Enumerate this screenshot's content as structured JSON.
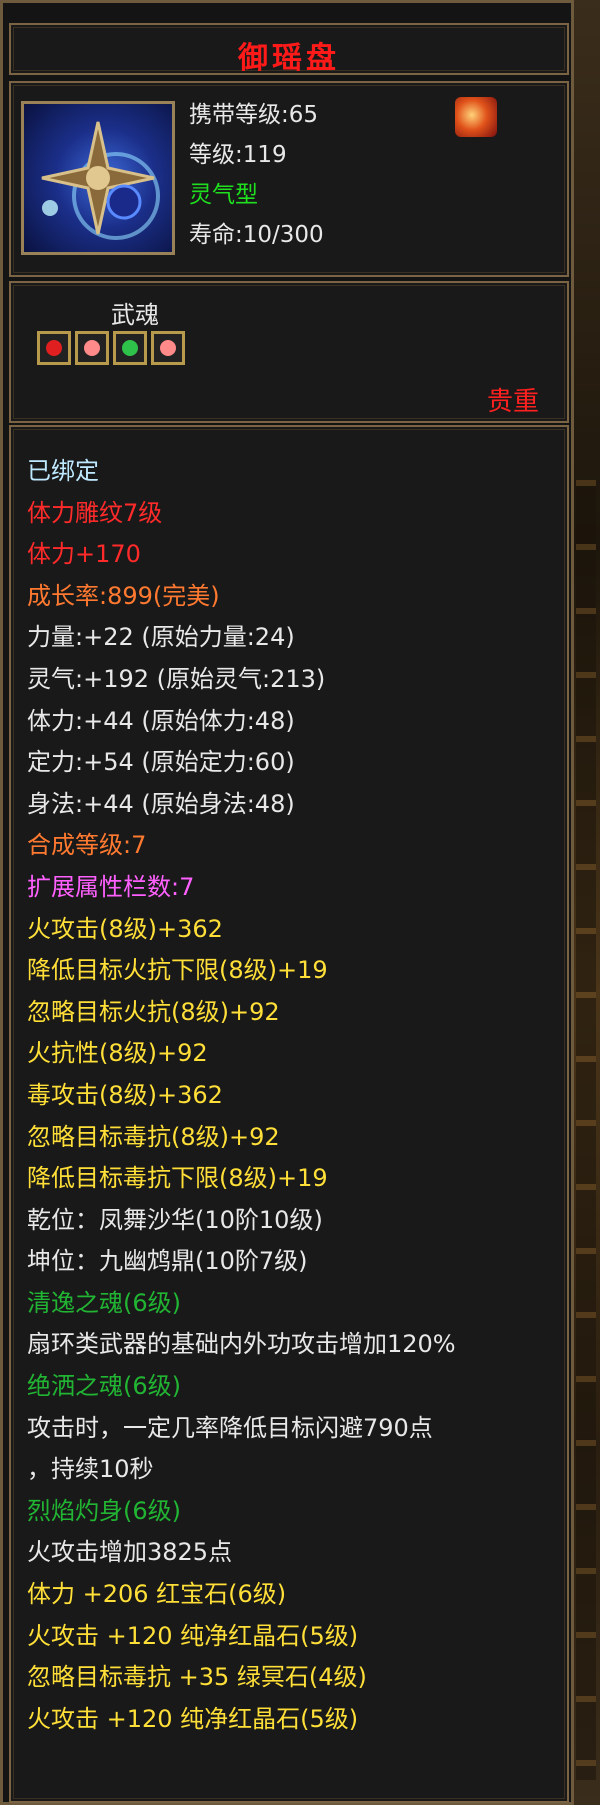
{
  "tooltip": {
    "title": "御瑶盘",
    "carry_level": "携带等级:65",
    "level": "等级:119",
    "type": "灵气型",
    "lifespan": "寿命:10/300",
    "soul_label": "武魂",
    "rarity": "贵重",
    "icons": {
      "item": "shuriken-disc-icon",
      "badge": "flame-badge-icon",
      "gems": [
        "red-gem-icon",
        "pink-gem-icon",
        "green-gem-icon",
        "pink-gem-icon"
      ]
    },
    "colors": {
      "title": "#ff1a1a",
      "green": "#1ee01e",
      "precious": "#ff2020",
      "gold": "#ffdf38"
    },
    "lines": [
      {
        "text": "已绑定",
        "color": "cyan"
      },
      {
        "text": "体力雕纹7级",
        "color": "red"
      },
      {
        "text": "体力+170",
        "color": "red"
      },
      {
        "text": "成长率:899(完美)",
        "color": "orange"
      },
      {
        "text": "力量:+22 (原始力量:24)",
        "color": "white"
      },
      {
        "text": "灵气:+192 (原始灵气:213)",
        "color": "white"
      },
      {
        "text": "体力:+44 (原始体力:48)",
        "color": "white"
      },
      {
        "text": "定力:+54 (原始定力:60)",
        "color": "white"
      },
      {
        "text": "身法:+44 (原始身法:48)",
        "color": "white"
      },
      {
        "text": "合成等级:7",
        "color": "orange"
      },
      {
        "text": "扩展属性栏数:7",
        "color": "pink"
      },
      {
        "text": "火攻击(8级)+362",
        "color": "yellow"
      },
      {
        "text": "降低目标火抗下限(8级)+19",
        "color": "yellow"
      },
      {
        "text": "忽略目标火抗(8级)+92",
        "color": "yellow"
      },
      {
        "text": "火抗性(8级)+92",
        "color": "yellow"
      },
      {
        "text": "毒攻击(8级)+362",
        "color": "yellow"
      },
      {
        "text": "忽略目标毒抗(8级)+92",
        "color": "yellow"
      },
      {
        "text": "降低目标毒抗下限(8级)+19",
        "color": "yellow"
      },
      {
        "text": "乾位：凤舞沙华(10阶10级)",
        "color": "white"
      },
      {
        "text": "坤位：九幽鸩鼎(10阶7级)",
        "color": "white"
      },
      {
        "text": "清逸之魂(6级)",
        "color": "green"
      },
      {
        "text": "扇环类武器的基础内外功攻击增加120%",
        "color": "white"
      },
      {
        "text": "绝洒之魂(6级)",
        "color": "green"
      },
      {
        "text": "攻击时，一定几率降低目标闪避790点",
        "color": "white"
      },
      {
        "text": "，持续10秒",
        "color": "white"
      },
      {
        "text": "烈焰灼身(6级)",
        "color": "green"
      },
      {
        "text": "火攻击增加3825点",
        "color": "white"
      },
      {
        "text": "体力 +206 红宝石(6级)",
        "color": "yellow"
      },
      {
        "text": "火攻击 +120 纯净红晶石(5级)",
        "color": "yellow"
      },
      {
        "text": "忽略目标毒抗 +35 绿冥石(4级)",
        "color": "yellow"
      },
      {
        "text": "火攻击 +120 纯净红晶石(5级)",
        "color": "yellow"
      }
    ]
  }
}
